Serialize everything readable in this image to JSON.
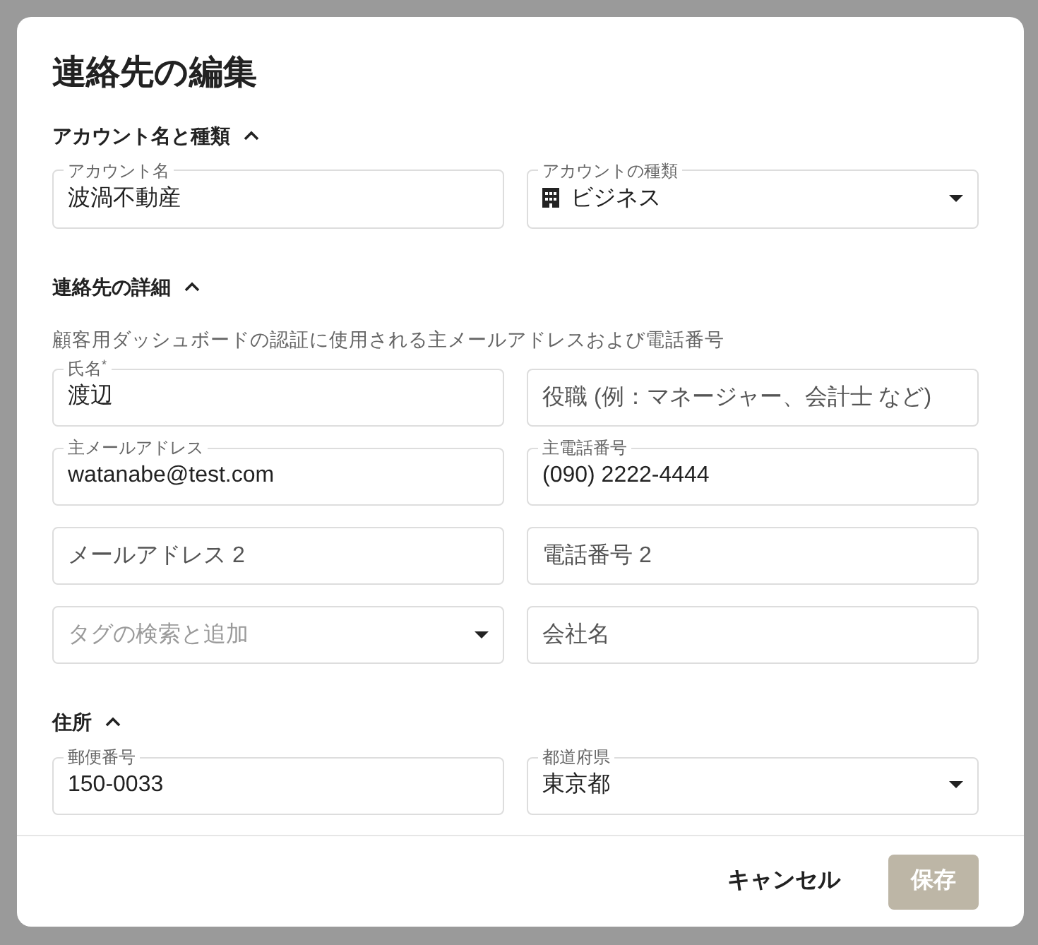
{
  "dialog": {
    "title": "連絡先の編集",
    "sections": [
      {
        "title": "アカウント名と種類",
        "expanded": true,
        "rows": [
          [
            {
              "kind": "text",
              "label": "アカウント名",
              "value": "波渦不動産"
            },
            {
              "kind": "select",
              "label": "アカウントの種類",
              "value": "ビジネス",
              "has_icon": true
            }
          ]
        ]
      },
      {
        "title": "連絡先の詳細",
        "expanded": true,
        "description": "顧客用ダッシュボードの認証に使用される主メールアドレスおよび電話番号",
        "rows": [
          [
            {
              "kind": "text",
              "label": "氏名$^{*}$",
              "value": "渡辺"
            },
            {
              "kind": "text",
              "placeholder": "役職 (例：マネージャー、会計士 など)"
            }
          ],
          [
            {
              "kind": "text",
              "label": "主メールアドレス",
              "value": "watanabe@test.com"
            },
            {
              "kind": "text",
              "label": "主電話番号",
              "value": "(090) 2222-4444"
            }
          ],
          [
            {
              "kind": "text",
              "placeholder": "メールアドレス 2"
            },
            {
              "kind": "text",
              "placeholder": "電話番号 2"
            }
          ],
          [
            {
              "kind": "select",
              "placeholder": "タグの検索と追加"
            },
            {
              "kind": "text",
              "placeholder": "会社名"
            }
          ]
        ]
      },
      {
        "title": "住所",
        "expanded": true,
        "rows": [
          [
            {
              "kind": "text",
              "label": "郵便番号",
              "value": "150-0033"
            },
            {
              "kind": "select",
              "label": "都道府県",
              "value": "東京都"
            }
          ]
        ]
      }
    ],
    "buttons": [
      {
        "kind": "text",
        "label": "キャンセル",
        "disabled": false
      },
      {
        "kind": "primary",
        "label": "保存",
        "disabled": true
      }
    ]
  }
}
